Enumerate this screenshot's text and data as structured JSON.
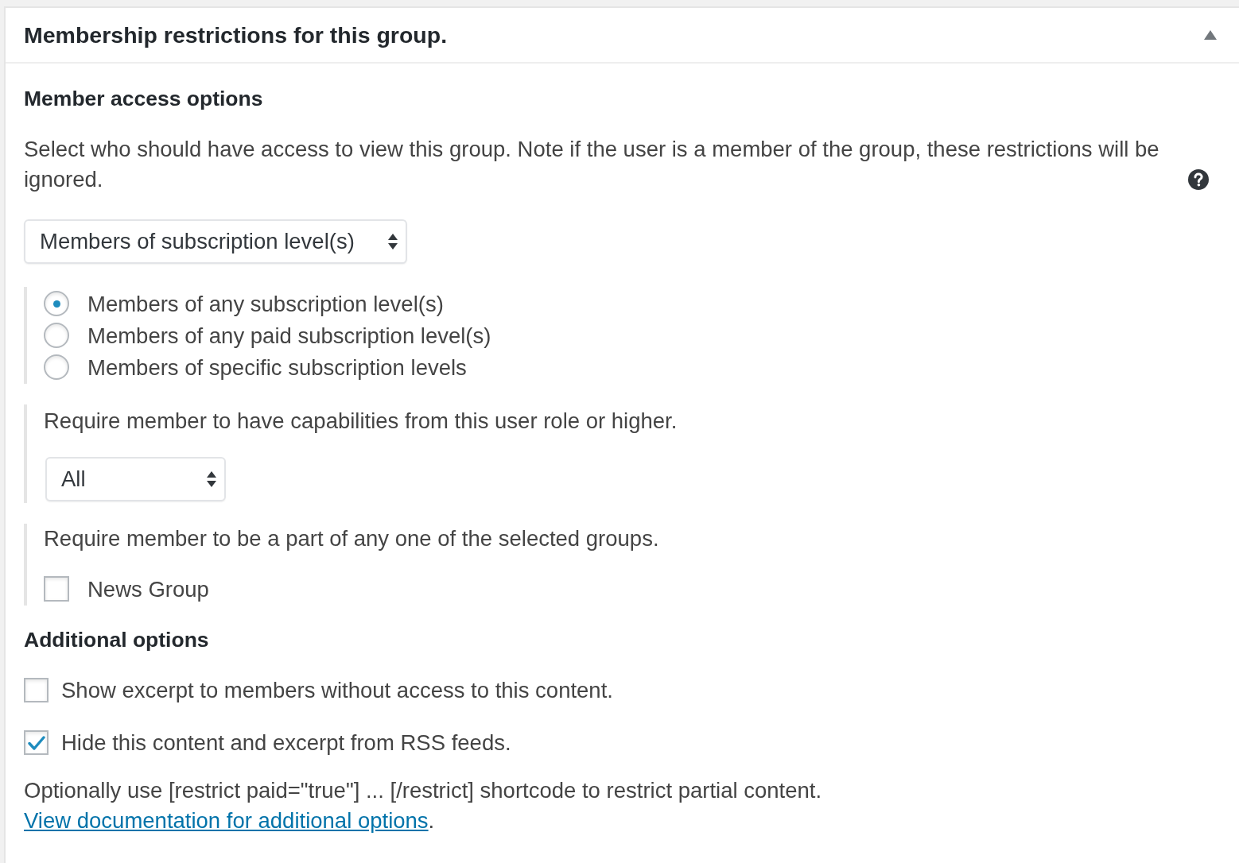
{
  "panel": {
    "title": "Membership restrictions for this group.",
    "expanded": true
  },
  "access": {
    "heading": "Member access options",
    "description": "Select who should have access to view this group. Note if the user is a member of the group, these restrictions will be ignored.",
    "select": {
      "value": "Members of subscription level(s)"
    },
    "level_options": [
      {
        "label": "Members of any subscription level(s)",
        "selected": true
      },
      {
        "label": "Members of any paid subscription level(s)",
        "selected": false
      },
      {
        "label": "Members of specific subscription levels",
        "selected": false
      }
    ],
    "role": {
      "text": "Require member to have capabilities from this user role or higher.",
      "select": {
        "value": "All"
      }
    },
    "groups": {
      "text": "Require member to be a part of any one of the selected groups.",
      "items": [
        {
          "label": "News Group",
          "checked": false
        }
      ]
    }
  },
  "additional": {
    "heading": "Additional options",
    "options": [
      {
        "label": "Show excerpt to members without access to this content.",
        "checked": false
      },
      {
        "label": "Hide this content and excerpt from RSS feeds.",
        "checked": true
      }
    ],
    "note": {
      "text": "Optionally use [restrict paid=\"true\"] ... [/restrict] shortcode to restrict partial content.",
      "link": "View documentation for additional options",
      "after": "."
    }
  }
}
